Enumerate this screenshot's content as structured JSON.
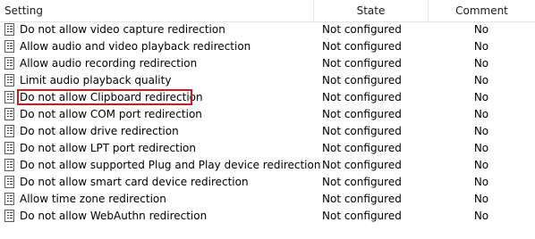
{
  "columns": {
    "setting": "Setting",
    "state": "State",
    "comment": "Comment"
  },
  "rows": [
    {
      "setting": "Do not allow video capture redirection",
      "state": "Not configured",
      "comment": "No"
    },
    {
      "setting": "Allow audio and video playback redirection",
      "state": "Not configured",
      "comment": "No"
    },
    {
      "setting": "Allow audio recording redirection",
      "state": "Not configured",
      "comment": "No"
    },
    {
      "setting": "Limit audio playback quality",
      "state": "Not configured",
      "comment": "No"
    },
    {
      "setting": "Do not allow Clipboard redirection",
      "state": "Not configured",
      "comment": "No",
      "highlighted": true
    },
    {
      "setting": "Do not allow COM port redirection",
      "state": "Not configured",
      "comment": "No"
    },
    {
      "setting": "Do not allow drive redirection",
      "state": "Not configured",
      "comment": "No"
    },
    {
      "setting": "Do not allow LPT port redirection",
      "state": "Not configured",
      "comment": "No"
    },
    {
      "setting": "Do not allow supported Plug and Play device redirection",
      "state": "Not configured",
      "comment": "No"
    },
    {
      "setting": "Do not allow smart card device redirection",
      "state": "Not configured",
      "comment": "No"
    },
    {
      "setting": "Allow time zone redirection",
      "state": "Not configured",
      "comment": "No"
    },
    {
      "setting": "Do not allow WebAuthn redirection",
      "state": "Not configured",
      "comment": "No"
    }
  ],
  "icons": {
    "row_icon": "policy-setting-icon"
  },
  "colors": {
    "highlight_border": "#d11a1a",
    "header_divider": "#e5e5e5"
  }
}
